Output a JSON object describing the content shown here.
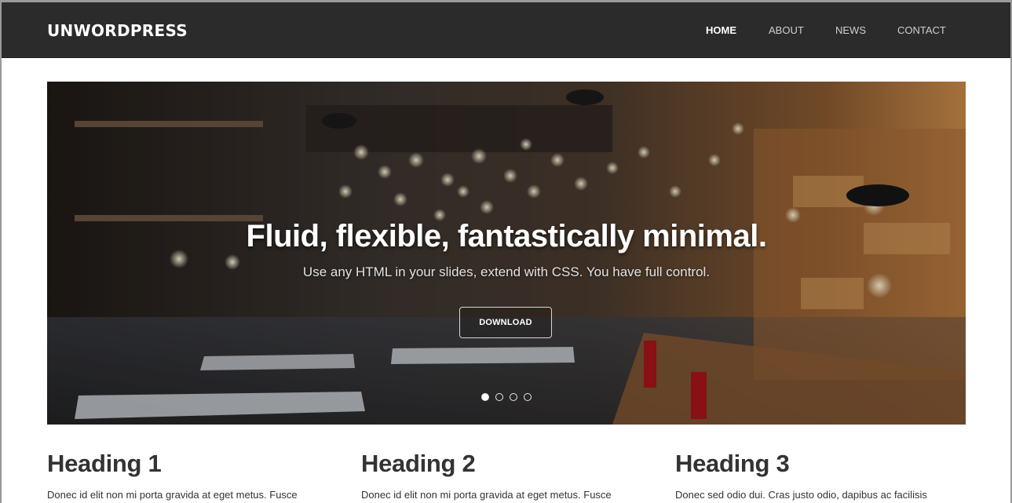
{
  "navbar": {
    "brand": "UNWORDPRESS",
    "items": [
      {
        "label": "HOME",
        "active": true
      },
      {
        "label": "ABOUT",
        "active": false
      },
      {
        "label": "NEWS",
        "active": false
      },
      {
        "label": "CONTACT",
        "active": false
      }
    ]
  },
  "hero": {
    "title": "Fluid, flexible, fantastically minimal.",
    "subtitle": "Use any HTML in your slides, extend with CSS. You have full control.",
    "button": "DOWNLOAD",
    "slides_total": 4,
    "active_slide": 1
  },
  "columns": [
    {
      "heading": "Heading 1",
      "text": "Donec id elit non mi porta gravida at eget metus. Fusce"
    },
    {
      "heading": "Heading 2",
      "text": "Donec id elit non mi porta gravida at eget metus. Fusce"
    },
    {
      "heading": "Heading 3",
      "text": "Donec sed odio dui. Cras justo odio, dapibus ac facilisis"
    }
  ],
  "colors": {
    "navbar_bg": "#2b2b2b",
    "text": "#333333"
  }
}
